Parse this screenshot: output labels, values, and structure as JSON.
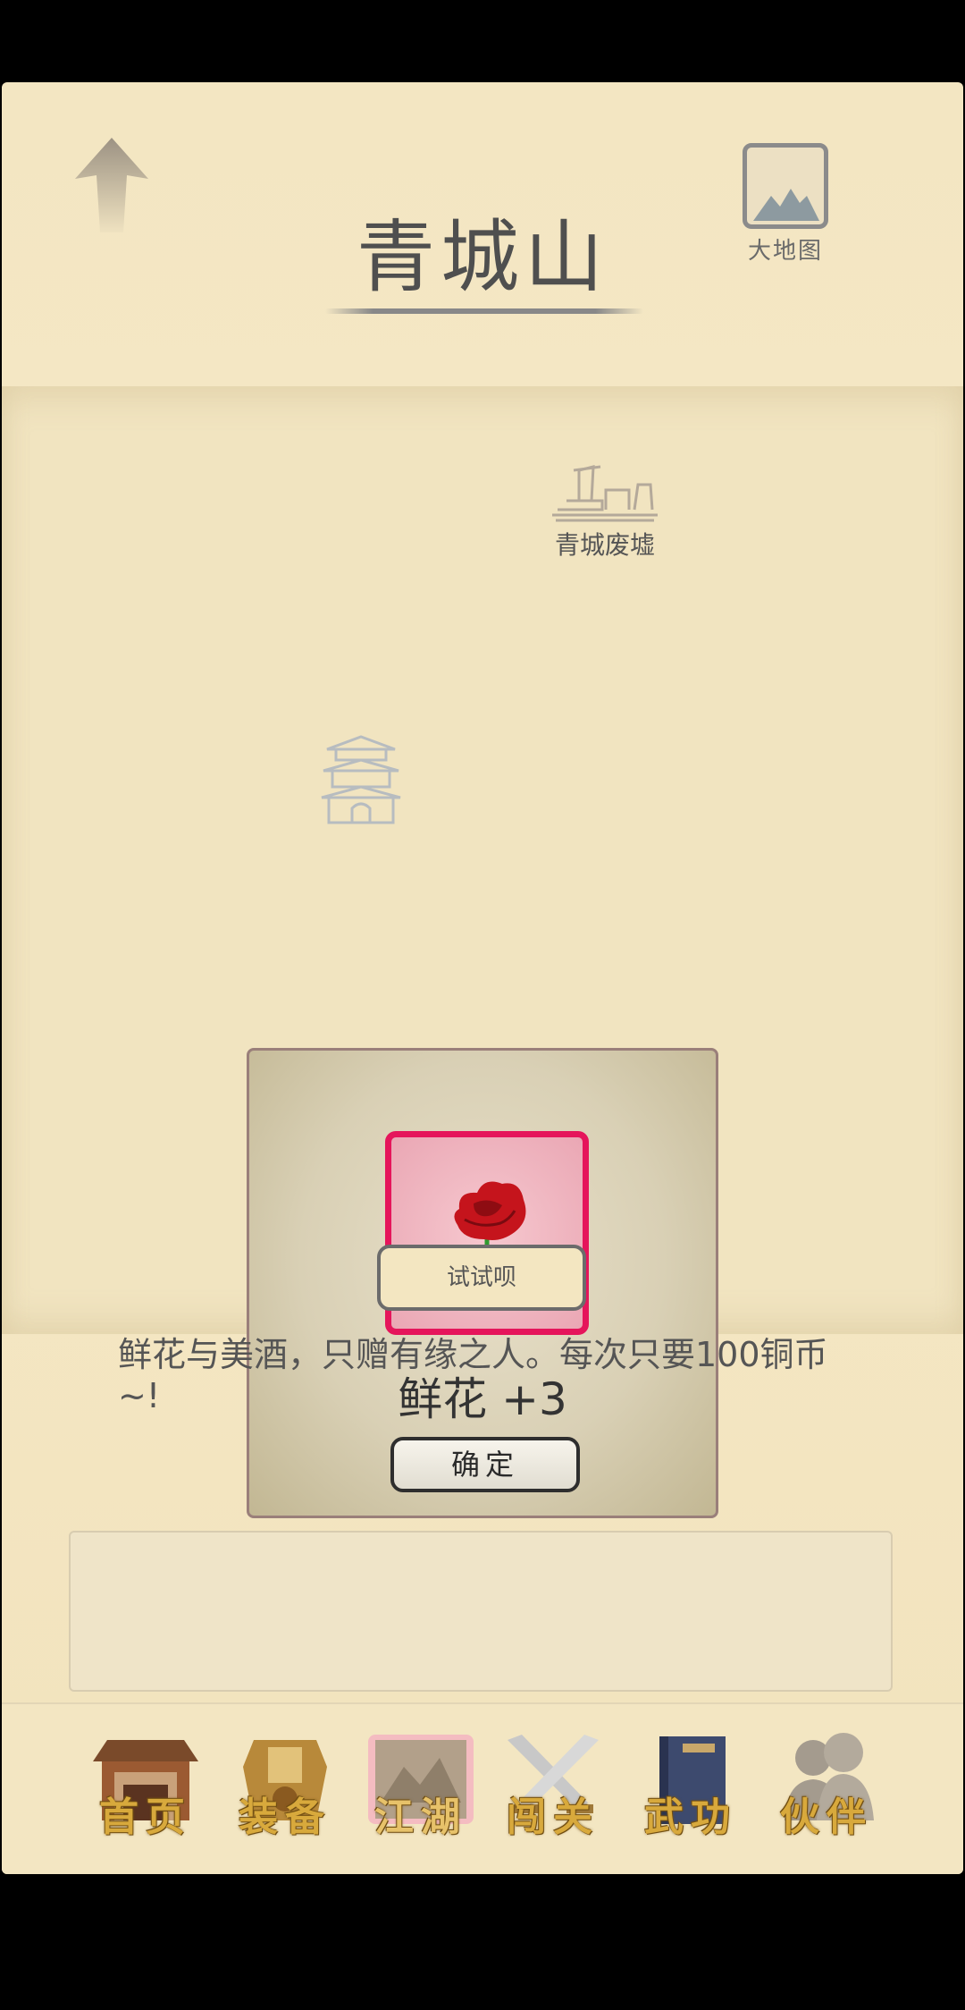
{
  "header": {
    "title": "青城山",
    "map_button_label": "大地图"
  },
  "map": {
    "locations": [
      {
        "label": "青城废墟",
        "icon": "ruins-icon"
      },
      {
        "label": "",
        "icon": "pagoda-icon"
      }
    ]
  },
  "dialog": {
    "item_name": "鲜花 +3",
    "item_icon": "rose-icon",
    "confirm_label": "确定"
  },
  "try_button_label": "试试呗",
  "description": "鲜花与美酒，只赠有缘之人。每次只要100铜币~!",
  "bottom_nav": {
    "items": [
      {
        "label": "首页",
        "icon": "house-icon"
      },
      {
        "label": "装备",
        "icon": "armor-icon"
      },
      {
        "label": "江湖",
        "icon": "scroll-icon",
        "active": true
      },
      {
        "label": "闯关",
        "icon": "swords-icon"
      },
      {
        "label": "武功",
        "icon": "book-icon"
      },
      {
        "label": "伙伴",
        "icon": "companions-icon"
      }
    ]
  },
  "colors": {
    "background": "#f3e6c2",
    "item_frame": "#e5155b",
    "nav_label": "#d8a93c"
  }
}
